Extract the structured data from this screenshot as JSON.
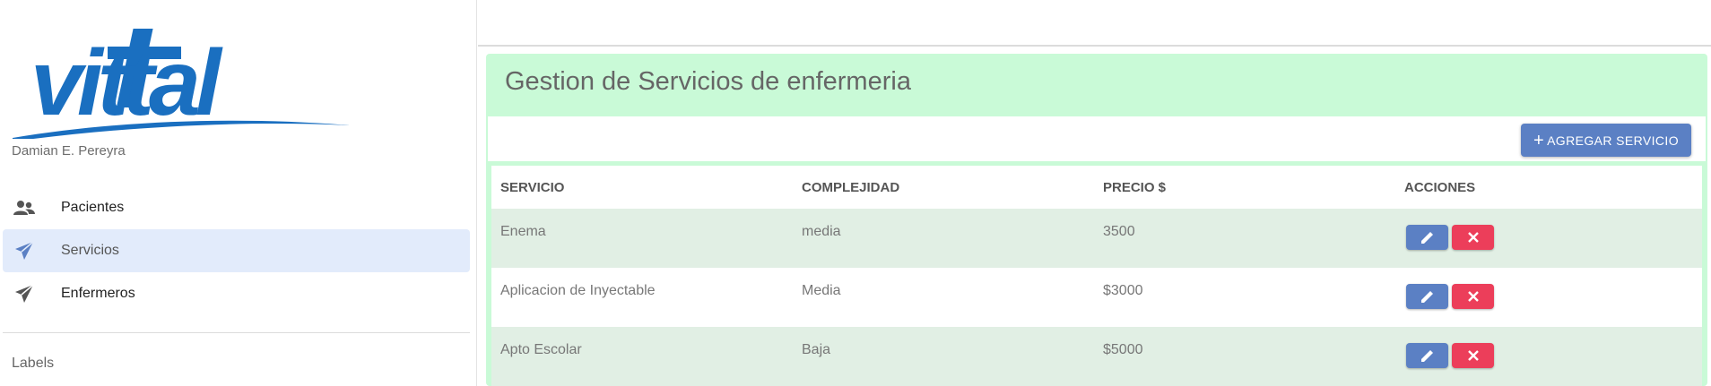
{
  "sidebar": {
    "logo_text": "vittal",
    "user_name": "Damian E. Pereyra",
    "items": [
      {
        "label": "Pacientes",
        "icon": "people-icon"
      },
      {
        "label": "Servicios",
        "icon": "send-icon",
        "active": true
      },
      {
        "label": "Enfermeros",
        "icon": "send-icon"
      }
    ],
    "labels_heading": "Labels"
  },
  "main": {
    "title": "Gestion de Servicios de enfermeria",
    "add_button_label": "AGREGAR SERVICIO",
    "table": {
      "headers": [
        "SERVICIO",
        "COMPLEJIDAD",
        "PRECIO $",
        "ACCIONES"
      ],
      "rows": [
        {
          "servicio": "Enema",
          "complejidad": "media",
          "precio": "3500"
        },
        {
          "servicio": "Aplicacion de Inyectable",
          "complejidad": "Media",
          "precio": "$3000"
        },
        {
          "servicio": "Apto Escolar",
          "complejidad": "Baja",
          "precio": "$5000"
        }
      ]
    }
  },
  "colors": {
    "brand_blue": "#1a6fc0",
    "primary": "#5b80c4",
    "danger": "#ec3e5a",
    "header_bg": "#c9fad7",
    "row_shade": "#e1efe4",
    "active_nav": "#e2ebfb"
  }
}
